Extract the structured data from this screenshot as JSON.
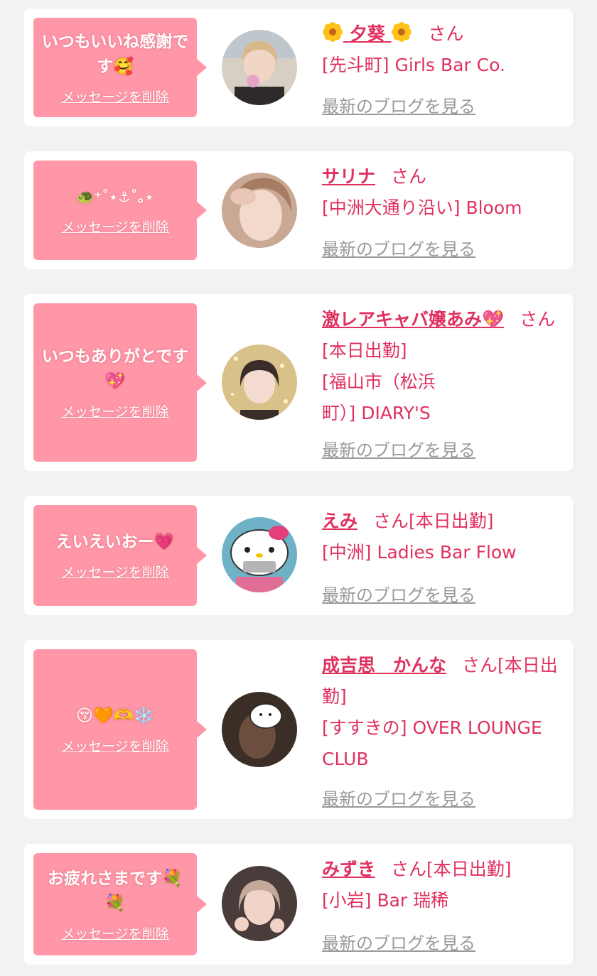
{
  "delete_label": "メッセージを削除",
  "blog_label": "最新のブログを見る",
  "honorific": "さん",
  "messages": [
    {
      "text": "いつもいいね感謝です🥰",
      "name": "夕葵",
      "name_emoji": "🌼",
      "status": "",
      "place": "[先斗町] Girls Bar Co."
    },
    {
      "text": "🐢⁺˚⋆⚓︎˚｡⋆",
      "name": "サリナ",
      "status": "",
      "place": "[中洲大通り沿い] Bloom"
    },
    {
      "text": "いつもありがとです💖",
      "name": "激レアキャバ嬢あみ💖",
      "status": "[本日出勤]",
      "place": "[福山市（松浜町）] DIARY'S"
    },
    {
      "text": "えいえいおー💗",
      "name": "えみ",
      "status": "[本日出勤]",
      "place": "[中洲] Ladies Bar Flow"
    },
    {
      "text": "😚🧡🫶❄️",
      "name": "成吉思　かんな",
      "status": "[本日出勤]",
      "place": "[すすきの] OVER LOUNGE CLUB"
    },
    {
      "text": "お疲れさまです💐💐",
      "name": "みずき",
      "status": "[本日出勤]",
      "place": "[小岩] Bar 瑞稀"
    }
  ],
  "colors": {
    "page_bg": "#f2f2f2",
    "card_bg": "#ffffff",
    "bubble_bg": "#ff97a8",
    "name_color": "#e0305e",
    "blog_link_color": "#9a9a9a"
  }
}
